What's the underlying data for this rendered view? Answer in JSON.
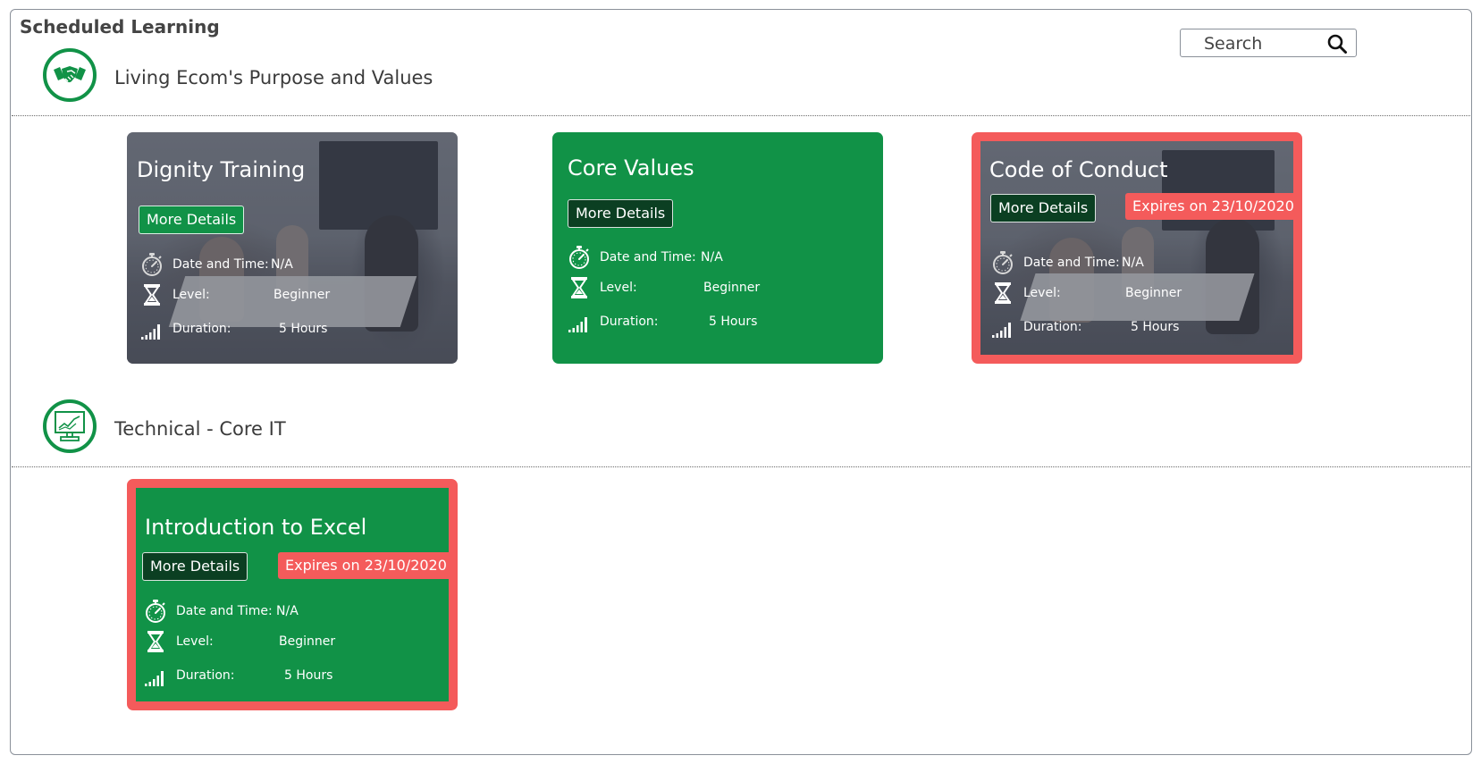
{
  "panel": {
    "title": "Scheduled Learning"
  },
  "search": {
    "placeholder": "Search"
  },
  "sections": [
    {
      "title": "Living Ecom's Purpose and Values",
      "icon": "handshake-icon",
      "cards": [
        {
          "title": "Dignity Training",
          "more_details": "More Details",
          "expires": "",
          "date_label": "Date and Time:",
          "date_value": "N/A",
          "level_label": "Level:",
          "level_value": "Beginner",
          "duration_label": "Duration:",
          "duration_value": "5 Hours"
        },
        {
          "title": "Core Values",
          "more_details": "More Details",
          "expires": "",
          "date_label": "Date and Time:",
          "date_value": "N/A",
          "level_label": "Level:",
          "level_value": "Beginner",
          "duration_label": "Duration:",
          "duration_value": "5 Hours"
        },
        {
          "title": "Code of Conduct",
          "more_details": "More Details",
          "expires": "Expires on 23/10/2020",
          "date_label": "Date and Time:",
          "date_value": "N/A",
          "level_label": "Level:",
          "level_value": "Beginner",
          "duration_label": "Duration:",
          "duration_value": "5 Hours"
        }
      ]
    },
    {
      "title": "Technical - Core IT",
      "icon": "presentation-chart-icon",
      "cards": [
        {
          "title": "Introduction to Excel",
          "more_details": "More Details",
          "expires": "Expires on 23/10/2020",
          "date_label": "Date and Time:",
          "date_value": "N/A",
          "level_label": "Level:",
          "level_value": "Beginner",
          "duration_label": "Duration:",
          "duration_value": "5 Hours"
        }
      ]
    }
  ],
  "colors": {
    "brand_green": "#119247",
    "dark_green": "#0b3f22",
    "expire_red": "#f45b5b"
  }
}
